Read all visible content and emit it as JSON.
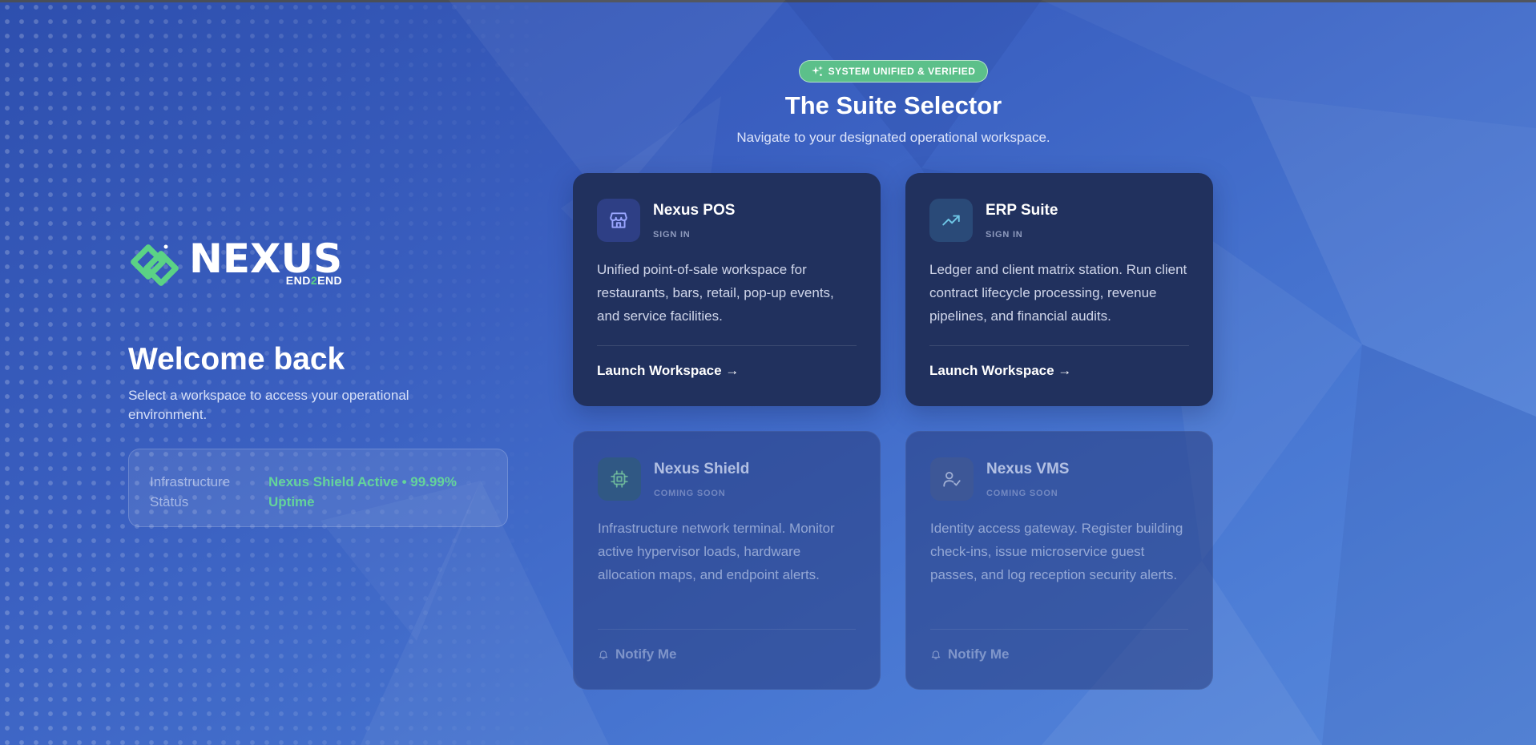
{
  "brand": {
    "name": "NEXUS",
    "tagline_a": "END",
    "tagline_b": "2",
    "tagline_c": "END",
    "accent": "#5bd285"
  },
  "left": {
    "heading": "Welcome back",
    "subheading": "Select a workspace to access your operational environment.",
    "status": {
      "label": "Infrastructure Status",
      "value": "Nexus Shield Active • 99.99% Uptime",
      "color": "#64d49a"
    }
  },
  "header": {
    "badge": "SYSTEM UNIFIED & VERIFIED",
    "badge_color": "#5cc08a",
    "title": "The Suite Selector",
    "subtitle": "Navigate to your designated operational workspace."
  },
  "cards": [
    {
      "title": "Nexus POS",
      "tag": "SIGN IN",
      "icon": "storefront-icon",
      "description": "Unified point-of-sale workspace for restaurants, bars, retail, pop-up events, and service facilities.",
      "action": "Launch Workspace →"
    },
    {
      "title": "ERP Suite",
      "tag": "SIGN IN",
      "icon": "trending-up-icon",
      "description": "Ledger and client matrix station. Run client contract lifecycle processing, revenue pipelines, and financial audits.",
      "action": "Launch Workspace →"
    },
    {
      "title": "Nexus Shield",
      "tag": "COMING SOON",
      "icon": "cpu-chip-icon",
      "description": "Infrastructure network terminal. Monitor active hypervisor loads, hardware allocation maps, and endpoint alerts.",
      "action": "Notify Me"
    },
    {
      "title": "Nexus VMS",
      "tag": "COMING SOON",
      "icon": "user-check-icon",
      "description": "Identity access gateway. Register building check-ins, issue microservice guest passes, and log reception security alerts.",
      "action": "Notify Me"
    }
  ]
}
